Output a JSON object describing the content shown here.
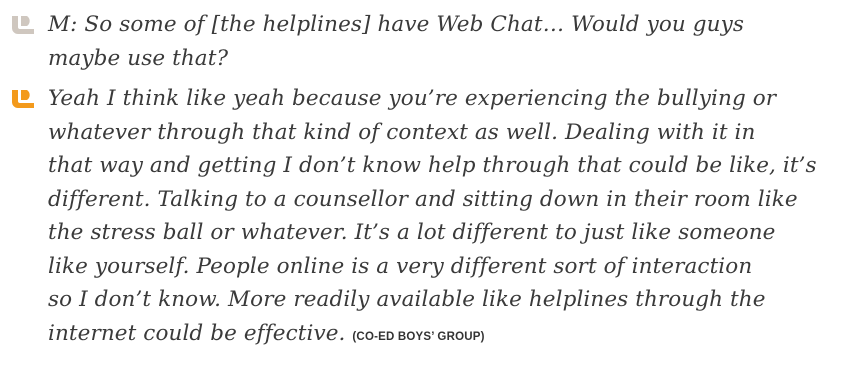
{
  "quotes": [
    {
      "icon": "speech-bubble-icon",
      "icon_color": "#cfc7bf",
      "text": "M: So some of [the helplines] have Web Chat… Would you guys\nmaybe use that?"
    },
    {
      "icon": "speech-bubble-icon",
      "icon_color": "#f39a1c",
      "text": "Yeah I think like yeah because you’re experiencing the bullying or\nwhatever through that kind of context as well. Dealing with it in\nthat way and getting I don’t know help through that could be like, it’s\ndifferent. Talking to a counsellor and sitting down in their room like\nthe stress ball or whatever. It’s a lot different to just like someone\nlike yourself. People online is a very different sort of interaction\nso I don’t know. More readily available like helplines through the\ninternet could be effective.",
      "source": "(CO-ED BOYS’ GROUP)"
    }
  ]
}
